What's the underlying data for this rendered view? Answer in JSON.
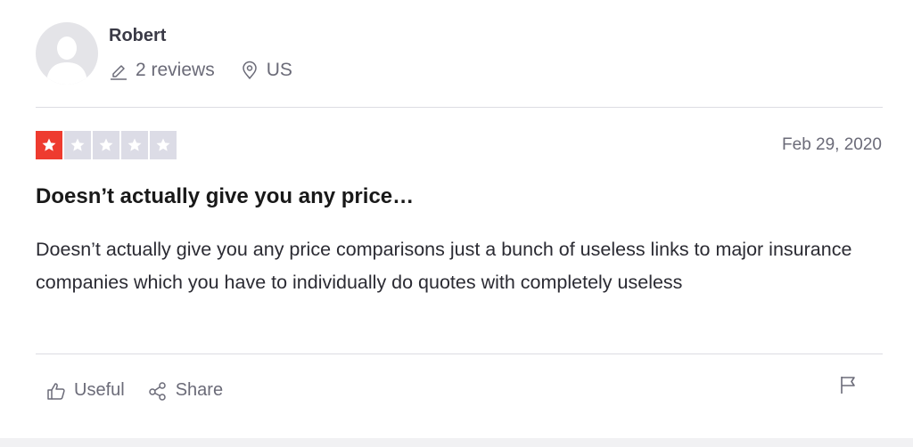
{
  "reviewer": {
    "name": "Robert",
    "review_count": "2 reviews",
    "location": "US",
    "icons": {
      "avatar": "user-silhouette",
      "reviews": "pencil-icon",
      "location": "location-pin-icon"
    }
  },
  "review": {
    "rating": 1,
    "rating_max": 5,
    "date": "Feb 29, 2020",
    "title": "Doesn’t actually give you any price…",
    "body": "Doesn’t actually give you any price comparisons just a bunch of useless links to major insurance companies which you have to individually do quotes with completely useless"
  },
  "actions": {
    "useful_label": "Useful",
    "share_label": "Share",
    "icons": {
      "useful": "thumbs-up-icon",
      "share": "share-icon",
      "report": "flag-icon"
    }
  },
  "colors": {
    "star_active": "#ee3b2f",
    "star_inactive": "#dcdce6",
    "muted_text": "#6b6b78"
  }
}
